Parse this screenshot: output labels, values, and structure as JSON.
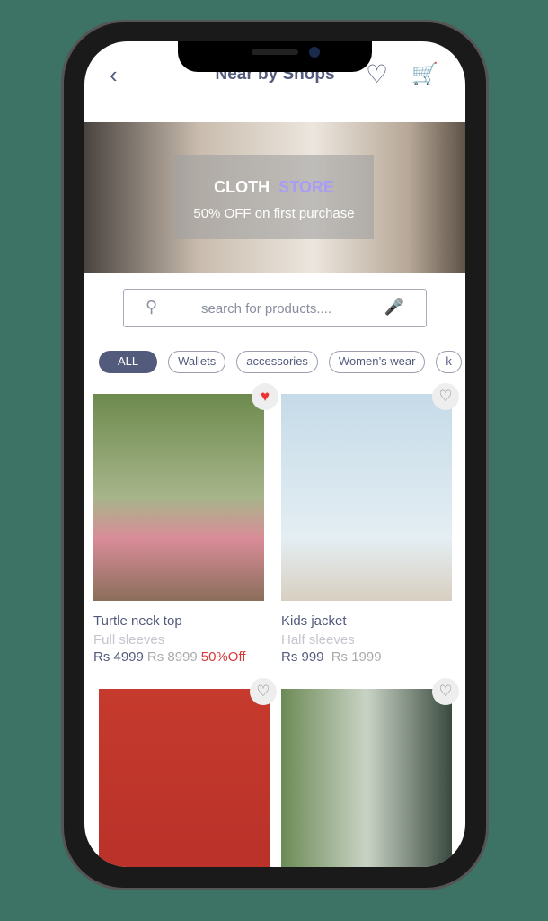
{
  "header": {
    "title": "Near by Shops",
    "back_icon": "chevron-left-icon",
    "wishlist_icon": "heart-icon",
    "cart_icon": "cart-icon"
  },
  "banner": {
    "title_a": "CLOTH",
    "title_b": "STORE",
    "subtitle": "50% OFF on first purchase"
  },
  "search": {
    "placeholder": "search for products...."
  },
  "chips": [
    "ALL",
    "Wallets",
    "accessories",
    "Women’s wear",
    "k"
  ],
  "products": [
    {
      "name": "Turtle neck top",
      "desc": "Full sleeves",
      "price": "Rs 4999",
      "old_price": "Rs 8999",
      "discount": "50%Off",
      "favorited": true
    },
    {
      "name": "Kids jacket",
      "desc": "Half sleeves",
      "price": "Rs 999",
      "old_price": "Rs 1999",
      "discount": "",
      "favorited": false
    },
    {
      "favorited": false
    },
    {
      "favorited": false
    }
  ],
  "colors": {
    "background": "#3d7365",
    "primary": "#535b7c",
    "discount": "#d23a3a"
  }
}
